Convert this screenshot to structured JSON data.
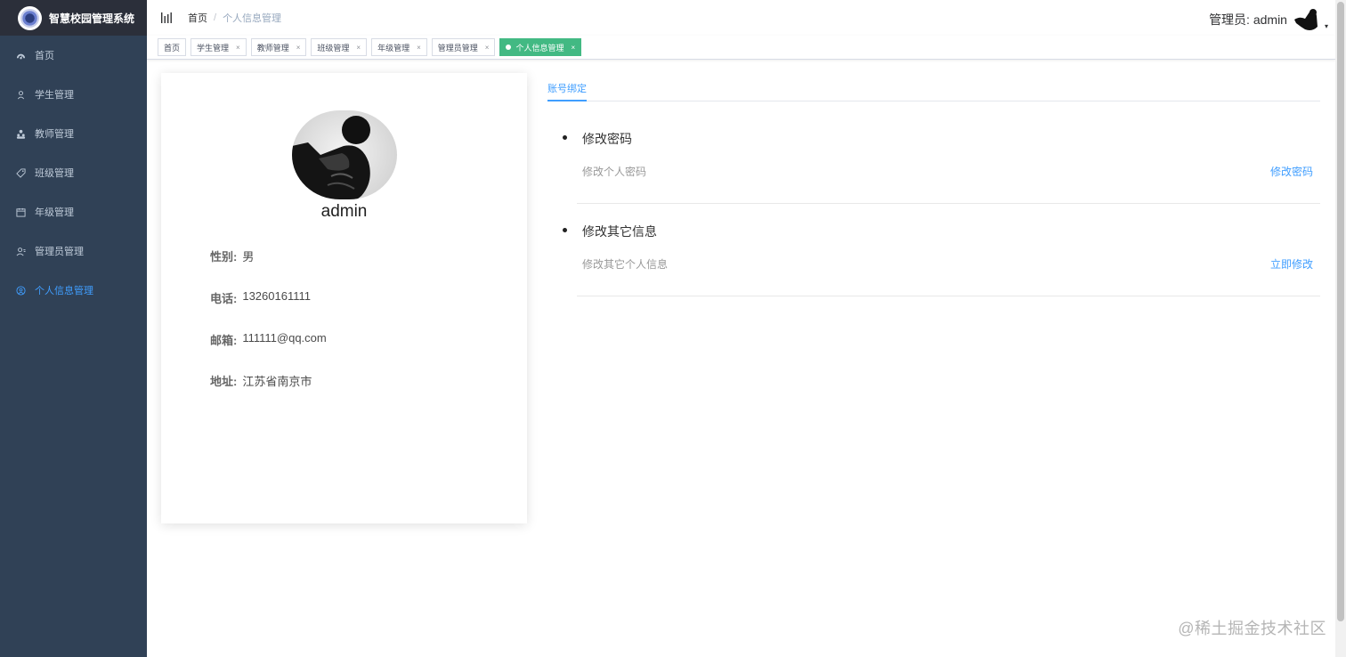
{
  "app": {
    "title": "智慧校园管理系统"
  },
  "sidebar": {
    "items": [
      {
        "label": "首页",
        "icon": "dashboard-icon",
        "active": false
      },
      {
        "label": "学生管理",
        "icon": "user-icon",
        "active": false
      },
      {
        "label": "教师管理",
        "icon": "peoples-icon",
        "active": false
      },
      {
        "label": "班级管理",
        "icon": "tag-icon",
        "active": false
      },
      {
        "label": "年级管理",
        "icon": "calendar-icon",
        "active": false
      },
      {
        "label": "管理员管理",
        "icon": "admin-icon",
        "active": false
      },
      {
        "label": "个人信息管理",
        "icon": "profile-icon",
        "active": true
      }
    ],
    "colors": {
      "background": "#304156",
      "text": "#bfcbd9",
      "active": "#409eff"
    }
  },
  "navbar": {
    "breadcrumb": {
      "home": "首页",
      "separator": "/",
      "current": "个人信息管理"
    },
    "user_label": "管理员: admin",
    "caret": "▾"
  },
  "tags": [
    {
      "label": "首页",
      "closable": false,
      "active": false
    },
    {
      "label": "学生管理",
      "closable": true,
      "active": false
    },
    {
      "label": "教师管理",
      "closable": true,
      "active": false
    },
    {
      "label": "班级管理",
      "closable": true,
      "active": false
    },
    {
      "label": "年级管理",
      "closable": true,
      "active": false
    },
    {
      "label": "管理员管理",
      "closable": true,
      "active": false
    },
    {
      "label": "个人信息管理",
      "closable": true,
      "active": true
    }
  ],
  "tag_close": "×",
  "profile": {
    "name": "admin",
    "fields": [
      {
        "label": "性别:",
        "value": "男"
      },
      {
        "label": "电话:",
        "value": "13260161111"
      },
      {
        "label": "邮箱:",
        "value": "111111@qq.com"
      },
      {
        "label": "地址:",
        "value": "江苏省南京市"
      }
    ]
  },
  "tabs": {
    "active_label": "账号绑定"
  },
  "settings": [
    {
      "title": "修改密码",
      "description": "修改个人密码",
      "action": "修改密码"
    },
    {
      "title": "修改其它信息",
      "description": "修改其它个人信息",
      "action": "立即修改"
    }
  ],
  "watermark": "@稀土掘金技术社区"
}
